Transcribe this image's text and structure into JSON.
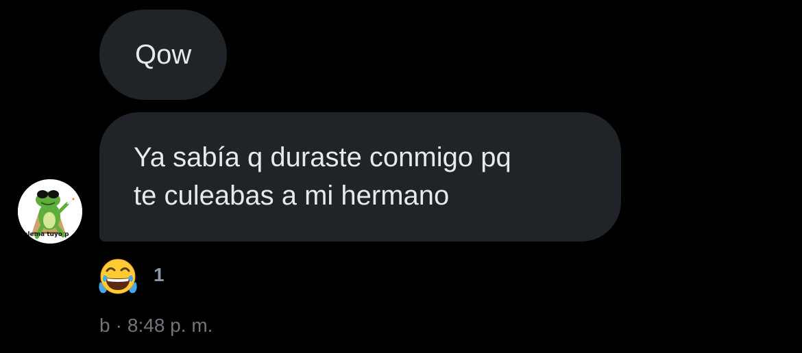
{
  "messages": [
    {
      "text_lines": [
        "Qow"
      ]
    },
    {
      "text_lines": [
        "Ya sabía q duraste conmigo pq",
        "te culeabas a mi hermano"
      ]
    }
  ],
  "avatar": {
    "icon": "frog-with-sunglasses-icon",
    "caption": "blema tuyo p"
  },
  "reaction": {
    "emoji": "😂",
    "icon": "face-with-tears-of-joy-icon",
    "count": "1"
  },
  "meta": {
    "sender": "b",
    "separator": "·",
    "time": "8:48 p. m."
  },
  "colors": {
    "background": "#000000",
    "bubble": "#202327",
    "text": "#e7e9ea",
    "muted": "#71767b"
  }
}
